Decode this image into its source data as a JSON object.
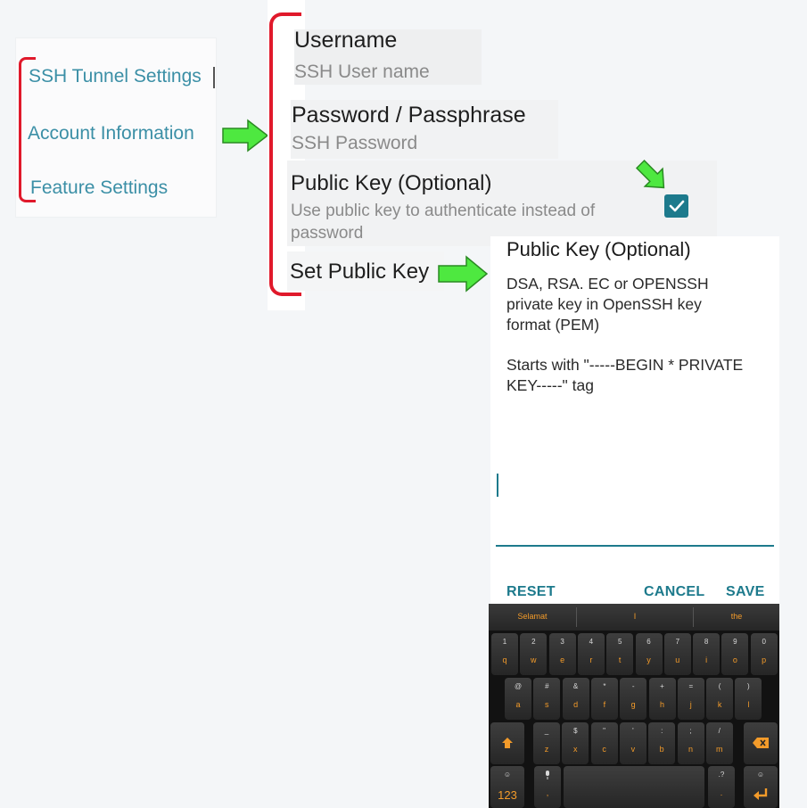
{
  "tabs": [
    {
      "label": "SSH Tunnel Settings"
    },
    {
      "label": "Account Information"
    },
    {
      "label": "Feature Settings"
    }
  ],
  "settings": {
    "username_title": "Username",
    "username_summary": "SSH User name",
    "password_title": "Password / Passphrase",
    "password_summary": "SSH Password",
    "public_key_title": "Public Key (Optional)",
    "public_key_summary_line1": "Use public key to authenticate instead of",
    "public_key_summary_line2": "password",
    "public_key_checked": true,
    "set_public_key_title": "Set Public Key"
  },
  "dialog": {
    "title": "Public Key (Optional)",
    "message_line1": "DSA, RSA. EC or OPENSSH",
    "message_line2": "private key in OpenSSH key",
    "message_line3": "format (PEM)",
    "message_line4": "Starts with \"-----BEGIN * PRIVATE",
    "message_line5": "KEY-----\" tag",
    "input_value": "",
    "reset_label": "RESET",
    "cancel_label": "CANCEL",
    "save_label": "SAVE"
  },
  "keyboard": {
    "suggestions": [
      "Selamat",
      "I",
      "the"
    ],
    "row1": [
      {
        "hint": "1",
        "key": "q"
      },
      {
        "hint": "2",
        "key": "w"
      },
      {
        "hint": "3",
        "key": "e"
      },
      {
        "hint": "4",
        "key": "r"
      },
      {
        "hint": "5",
        "key": "t"
      },
      {
        "hint": "6",
        "key": "y"
      },
      {
        "hint": "7",
        "key": "u"
      },
      {
        "hint": "8",
        "key": "i"
      },
      {
        "hint": "9",
        "key": "o"
      },
      {
        "hint": "0",
        "key": "p"
      }
    ],
    "row2": [
      {
        "hint": "@",
        "key": "a"
      },
      {
        "hint": "#",
        "key": "s"
      },
      {
        "hint": "&",
        "key": "d"
      },
      {
        "hint": "*",
        "key": "f"
      },
      {
        "hint": "-",
        "key": "g"
      },
      {
        "hint": "+",
        "key": "h"
      },
      {
        "hint": "=",
        "key": "j"
      },
      {
        "hint": "(",
        "key": "k"
      },
      {
        "hint": ")",
        "key": "l"
      }
    ],
    "row3": [
      {
        "hint": "_",
        "key": "z"
      },
      {
        "hint": "$",
        "key": "x"
      },
      {
        "hint": "\"",
        "key": "c"
      },
      {
        "hint": "'",
        "key": "v"
      },
      {
        "hint": ":",
        "key": "b"
      },
      {
        "hint": ";",
        "key": "n"
      },
      {
        "hint": "/",
        "key": "m"
      }
    ],
    "symbols_label": "123",
    "comma_key": ",",
    "period_key": ".",
    "colors": {
      "accent": "#f39b2a",
      "key_text": "#d9d9d9"
    }
  },
  "colors": {
    "teal": "#1d7a8c",
    "tab_text": "#3b8fa6",
    "bracket_red": "#e0192b",
    "arrow_green": "#4ee840"
  },
  "icons": [
    "check-icon",
    "shift-arrow-icon",
    "backspace-icon",
    "microphone-icon",
    "enter-icon",
    "emoji-icon"
  ]
}
